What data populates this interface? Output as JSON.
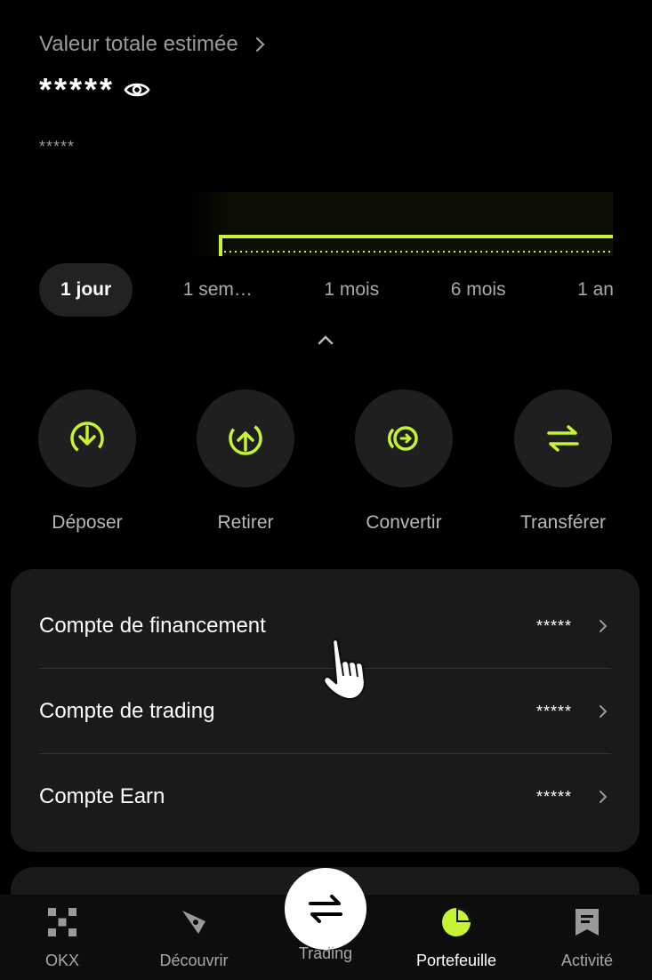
{
  "header": {
    "total_label": "Valeur totale estimée",
    "masked_total": "*****",
    "masked_change": "*****"
  },
  "time_range": {
    "options": [
      "1 jour",
      "1 sem…",
      "1 mois",
      "6 mois",
      "1 an"
    ],
    "selected": "1 jour"
  },
  "actions": [
    {
      "label": "Déposer",
      "icon": "deposit-icon"
    },
    {
      "label": "Retirer",
      "icon": "withdraw-icon"
    },
    {
      "label": "Convertir",
      "icon": "convert-icon"
    },
    {
      "label": "Transférer",
      "icon": "transfer-icon"
    }
  ],
  "accounts": [
    {
      "name": "Compte de financement",
      "value": "*****"
    },
    {
      "name": "Compte de trading",
      "value": "*****"
    },
    {
      "name": "Compte Earn",
      "value": "*****"
    }
  ],
  "bottom_nav": {
    "items": [
      {
        "label": "OKX",
        "icon": "okx-logo-icon"
      },
      {
        "label": "Découvrir",
        "icon": "compass-icon"
      },
      {
        "label": "Trading",
        "icon": "swap-arrows-icon"
      },
      {
        "label": "Portefeuille",
        "icon": "pie-chart-icon"
      },
      {
        "label": "Activité",
        "icon": "receipt-icon"
      }
    ],
    "active": "Portefeuille"
  },
  "colors": {
    "accent": "#c6f432",
    "background": "#000000",
    "card": "#1a1a1a",
    "muted_text": "#a8a8a8"
  }
}
